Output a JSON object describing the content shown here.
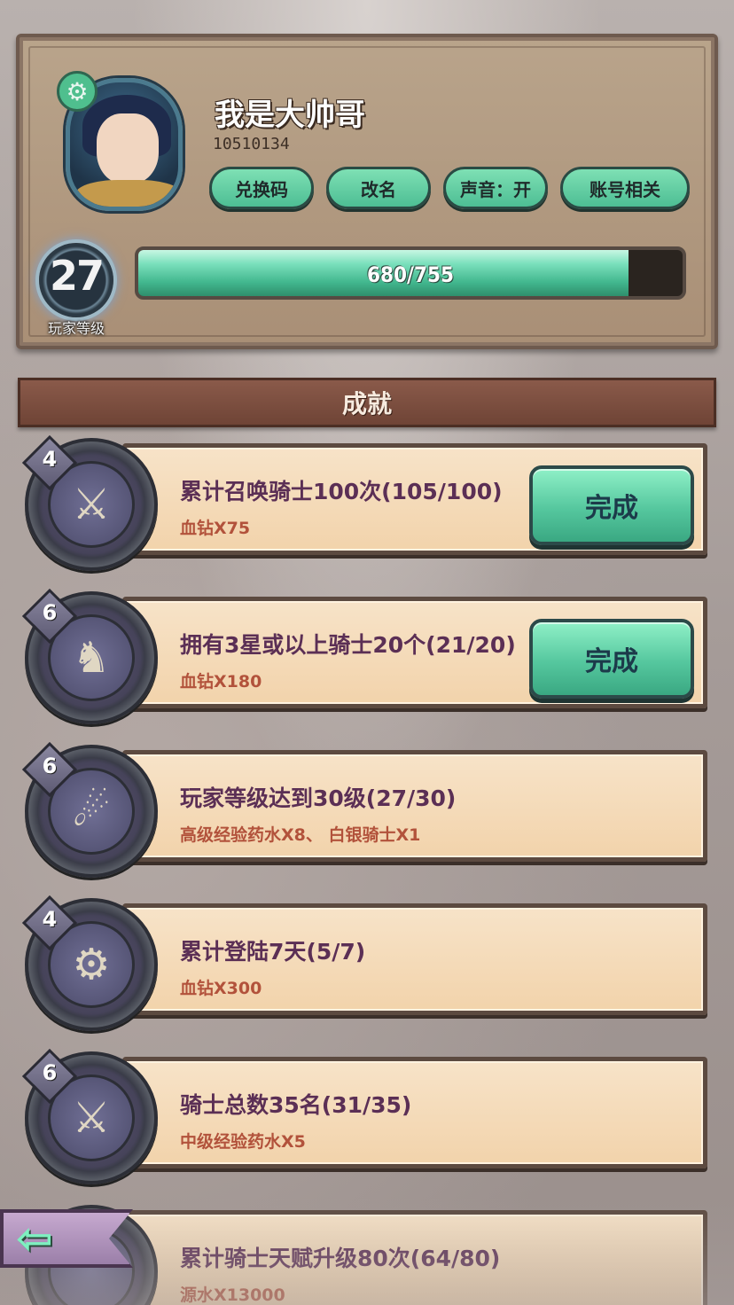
{
  "profile": {
    "name": "我是大帅哥",
    "id": "10510134",
    "level": "27",
    "level_label": "玩家等级",
    "xp_text": "680/755",
    "xp_fraction": 0.9,
    "buttons": [
      "兑换码",
      "改名",
      "声音：开",
      "账号相关"
    ]
  },
  "section": {
    "title": "成就"
  },
  "achievements": [
    {
      "badge": "4",
      "title": "累计召唤骑士100次(105/100)",
      "reward": "血钻X75",
      "action": "完成",
      "icon": "knights-icon"
    },
    {
      "badge": "6",
      "title": "拥有3星或以上骑士20个(21/20)",
      "reward": "血钻X180",
      "action": "完成",
      "icon": "knight-hat-icon"
    },
    {
      "badge": "6",
      "title": "玩家等级达到30级(27/30)",
      "reward": "高级经验药水X8、 白银骑士X1",
      "action": "",
      "icon": "blue-flame-icon"
    },
    {
      "badge": "4",
      "title": "累计登陆7天(5/7)",
      "reward": "血钻X300",
      "action": "",
      "icon": "crown-gear-icon"
    },
    {
      "badge": "6",
      "title": "骑士总数35名(31/35)",
      "reward": "中级经验药水X5",
      "action": "",
      "icon": "knights-icon"
    },
    {
      "badge": "",
      "title": "累计骑士天赋升级80次(64/80)",
      "reward": "源水X13000",
      "action": "",
      "icon": ""
    }
  ],
  "back": {
    "icon": "back-arrow-icon"
  }
}
